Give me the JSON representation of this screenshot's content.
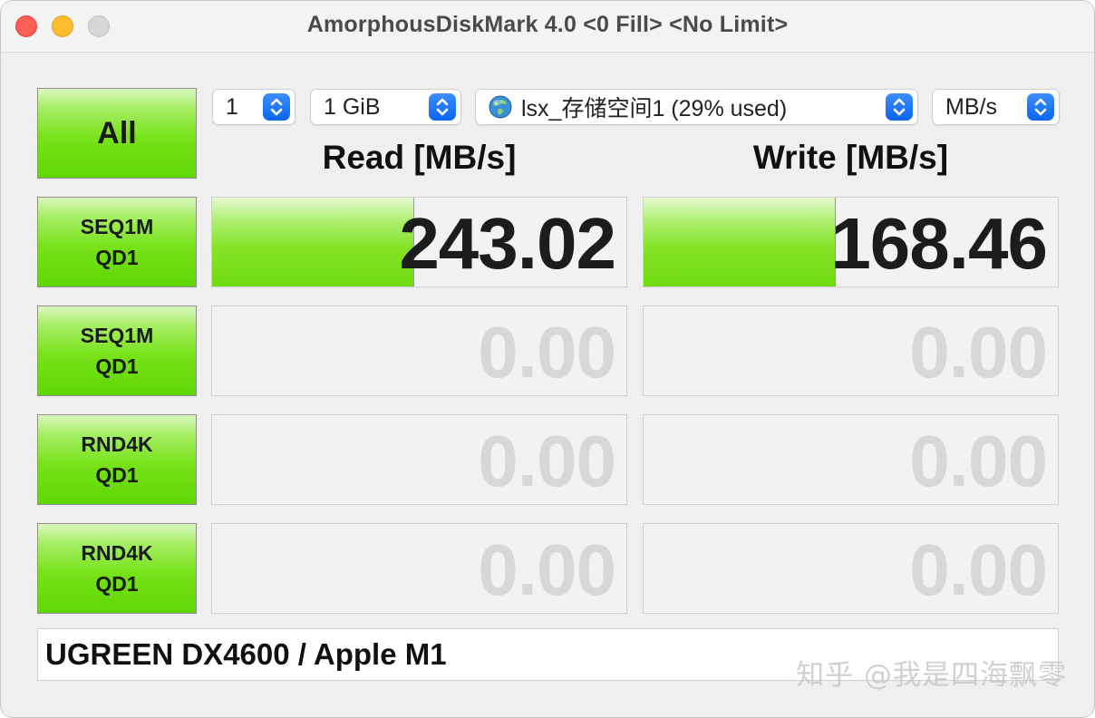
{
  "window": {
    "title": "AmorphousDiskMark 4.0 <0 Fill> <No Limit>"
  },
  "controls": {
    "all_button": "All",
    "count": "1",
    "size": "1 GiB",
    "target": "lsx_存储空间1 (29% used)",
    "target_icon": "globe-icon",
    "unit": "MB/s"
  },
  "headers": {
    "read": "Read [MB/s]",
    "write": "Write [MB/s]"
  },
  "tests": [
    {
      "line1": "SEQ1M",
      "line2": "QD1",
      "read": "243.02",
      "write": "168.46",
      "read_fill": 0.485,
      "write_fill": 0.462
    },
    {
      "line1": "SEQ1M",
      "line2": "QD1",
      "read": "0.00",
      "write": "0.00",
      "read_fill": 0,
      "write_fill": 0
    },
    {
      "line1": "RND4K",
      "line2": "QD1",
      "read": "0.00",
      "write": "0.00",
      "read_fill": 0,
      "write_fill": 0
    },
    {
      "line1": "RND4K",
      "line2": "QD1",
      "read": "0.00",
      "write": "0.00",
      "read_fill": 0,
      "write_fill": 0
    }
  ],
  "footer": {
    "comment": "UGREEN DX4600 / Apple M1"
  },
  "watermark": "知乎 @我是四海飘零",
  "colors": {
    "bar_green": "#6fdc10",
    "button_green": "#60d604",
    "select_blue": "#0a66f0",
    "zero_text": "#d7d7d7"
  }
}
